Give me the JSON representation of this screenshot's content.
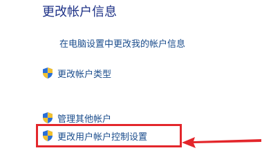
{
  "section": {
    "title": "更改帐户信息",
    "pc_settings_link": "在电脑设置中更改我的帐户信息"
  },
  "tasks": [
    {
      "label": "更改帐户类型",
      "icon": "uac-shield-icon"
    },
    {
      "label": "管理其他帐户",
      "icon": "uac-shield-icon"
    },
    {
      "label": "更改用户帐户控制设置",
      "icon": "uac-shield-icon"
    }
  ],
  "annotation": {
    "highlight_color": "#e3262b"
  },
  "colors": {
    "heading": "#1e3287",
    "link": "#1a4c8c",
    "shield_blue": "#2a6fd6",
    "shield_yellow": "#f2c12e"
  }
}
